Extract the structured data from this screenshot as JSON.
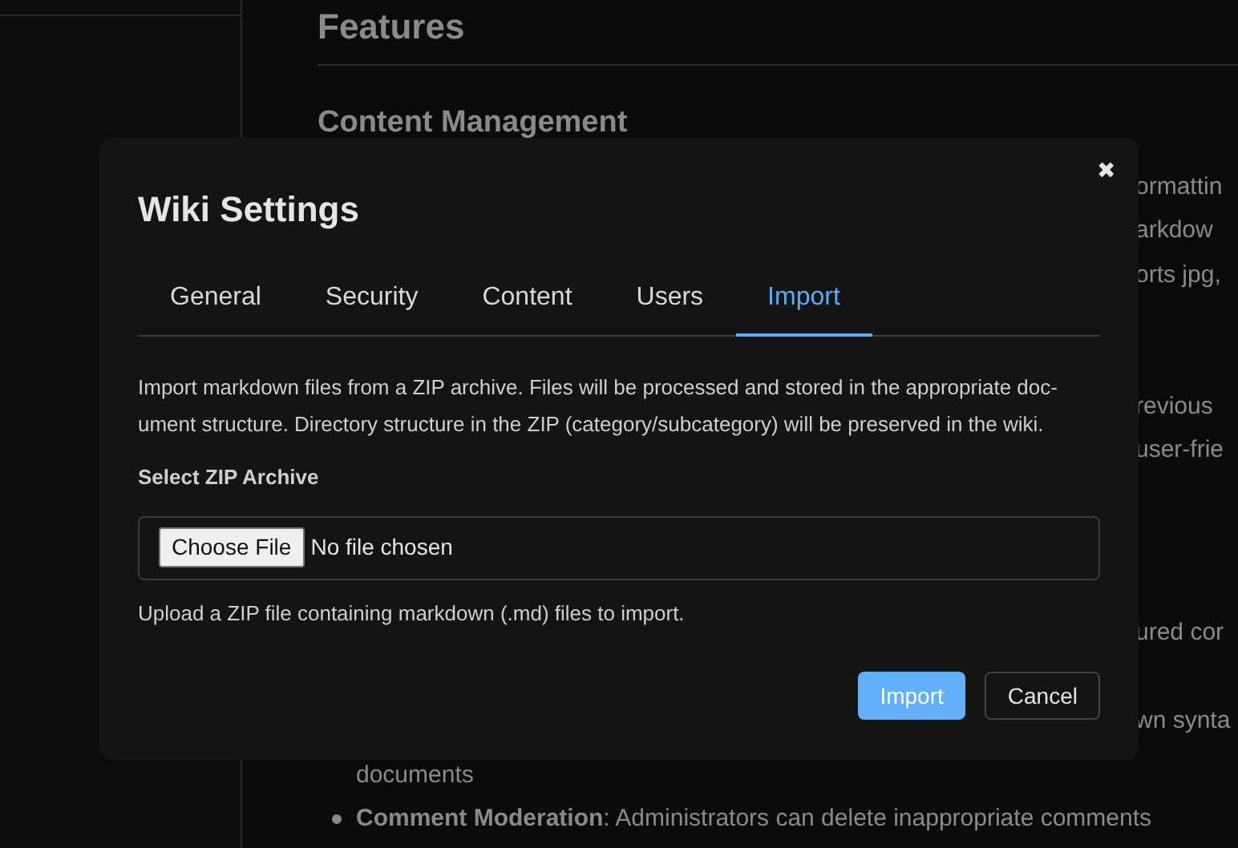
{
  "page": {
    "heading": "Features",
    "section": "Content Management",
    "fragments": [
      "ormattin",
      "arkdow",
      "orts jpg,",
      "revious",
      "user-frie",
      "ured cor",
      "wn synta"
    ],
    "wrapped_line": "documents",
    "list_items": [
      "**Comment Moderation**: Administrators can delete inappropriate comments"
    ]
  },
  "dialog": {
    "title": "Wiki Settings",
    "close": "✖",
    "tabs": [
      {
        "label": "General",
        "selected": false
      },
      {
        "label": "Security",
        "selected": false
      },
      {
        "label": "Content",
        "selected": false
      },
      {
        "label": "Users",
        "selected": false
      },
      {
        "label": "Import",
        "selected": true
      }
    ],
    "description": [
      "Import markdown files from a ZIP archive. Files will be processed and stored in the appropriate doc-",
      "ument structure. Directory structure in the ZIP (category/subcategory) will be preserved in the wiki."
    ],
    "field_label": "Select ZIP Archive",
    "file_button": "Choose File",
    "file_status": "No file chosen",
    "help": "Upload a ZIP file containing markdown (.md) files to import.",
    "buttons": [
      {
        "label": "Import",
        "kind": "primary"
      },
      {
        "label": "Cancel",
        "kind": "secondary"
      }
    ]
  }
}
